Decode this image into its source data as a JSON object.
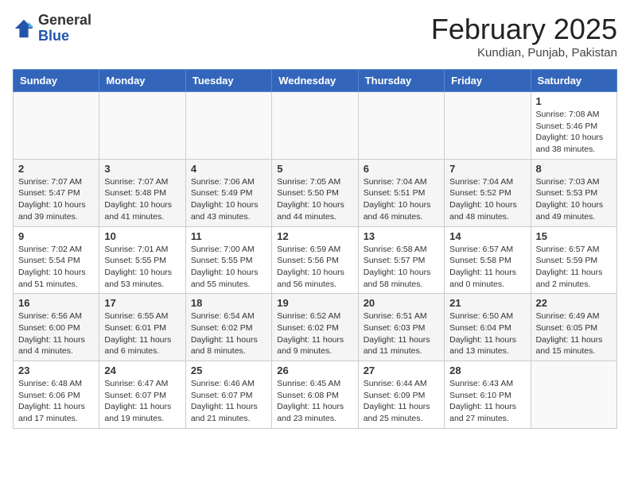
{
  "header": {
    "logo_general": "General",
    "logo_blue": "Blue",
    "month_title": "February 2025",
    "location": "Kundian, Punjab, Pakistan"
  },
  "days_of_week": [
    "Sunday",
    "Monday",
    "Tuesday",
    "Wednesday",
    "Thursday",
    "Friday",
    "Saturday"
  ],
  "weeks": [
    [
      {
        "day": "",
        "info": ""
      },
      {
        "day": "",
        "info": ""
      },
      {
        "day": "",
        "info": ""
      },
      {
        "day": "",
        "info": ""
      },
      {
        "day": "",
        "info": ""
      },
      {
        "day": "",
        "info": ""
      },
      {
        "day": "1",
        "info": "Sunrise: 7:08 AM\nSunset: 5:46 PM\nDaylight: 10 hours\nand 38 minutes."
      }
    ],
    [
      {
        "day": "2",
        "info": "Sunrise: 7:07 AM\nSunset: 5:47 PM\nDaylight: 10 hours\nand 39 minutes."
      },
      {
        "day": "3",
        "info": "Sunrise: 7:07 AM\nSunset: 5:48 PM\nDaylight: 10 hours\nand 41 minutes."
      },
      {
        "day": "4",
        "info": "Sunrise: 7:06 AM\nSunset: 5:49 PM\nDaylight: 10 hours\nand 43 minutes."
      },
      {
        "day": "5",
        "info": "Sunrise: 7:05 AM\nSunset: 5:50 PM\nDaylight: 10 hours\nand 44 minutes."
      },
      {
        "day": "6",
        "info": "Sunrise: 7:04 AM\nSunset: 5:51 PM\nDaylight: 10 hours\nand 46 minutes."
      },
      {
        "day": "7",
        "info": "Sunrise: 7:04 AM\nSunset: 5:52 PM\nDaylight: 10 hours\nand 48 minutes."
      },
      {
        "day": "8",
        "info": "Sunrise: 7:03 AM\nSunset: 5:53 PM\nDaylight: 10 hours\nand 49 minutes."
      }
    ],
    [
      {
        "day": "9",
        "info": "Sunrise: 7:02 AM\nSunset: 5:54 PM\nDaylight: 10 hours\nand 51 minutes."
      },
      {
        "day": "10",
        "info": "Sunrise: 7:01 AM\nSunset: 5:55 PM\nDaylight: 10 hours\nand 53 minutes."
      },
      {
        "day": "11",
        "info": "Sunrise: 7:00 AM\nSunset: 5:55 PM\nDaylight: 10 hours\nand 55 minutes."
      },
      {
        "day": "12",
        "info": "Sunrise: 6:59 AM\nSunset: 5:56 PM\nDaylight: 10 hours\nand 56 minutes."
      },
      {
        "day": "13",
        "info": "Sunrise: 6:58 AM\nSunset: 5:57 PM\nDaylight: 10 hours\nand 58 minutes."
      },
      {
        "day": "14",
        "info": "Sunrise: 6:57 AM\nSunset: 5:58 PM\nDaylight: 11 hours\nand 0 minutes."
      },
      {
        "day": "15",
        "info": "Sunrise: 6:57 AM\nSunset: 5:59 PM\nDaylight: 11 hours\nand 2 minutes."
      }
    ],
    [
      {
        "day": "16",
        "info": "Sunrise: 6:56 AM\nSunset: 6:00 PM\nDaylight: 11 hours\nand 4 minutes."
      },
      {
        "day": "17",
        "info": "Sunrise: 6:55 AM\nSunset: 6:01 PM\nDaylight: 11 hours\nand 6 minutes."
      },
      {
        "day": "18",
        "info": "Sunrise: 6:54 AM\nSunset: 6:02 PM\nDaylight: 11 hours\nand 8 minutes."
      },
      {
        "day": "19",
        "info": "Sunrise: 6:52 AM\nSunset: 6:02 PM\nDaylight: 11 hours\nand 9 minutes."
      },
      {
        "day": "20",
        "info": "Sunrise: 6:51 AM\nSunset: 6:03 PM\nDaylight: 11 hours\nand 11 minutes."
      },
      {
        "day": "21",
        "info": "Sunrise: 6:50 AM\nSunset: 6:04 PM\nDaylight: 11 hours\nand 13 minutes."
      },
      {
        "day": "22",
        "info": "Sunrise: 6:49 AM\nSunset: 6:05 PM\nDaylight: 11 hours\nand 15 minutes."
      }
    ],
    [
      {
        "day": "23",
        "info": "Sunrise: 6:48 AM\nSunset: 6:06 PM\nDaylight: 11 hours\nand 17 minutes."
      },
      {
        "day": "24",
        "info": "Sunrise: 6:47 AM\nSunset: 6:07 PM\nDaylight: 11 hours\nand 19 minutes."
      },
      {
        "day": "25",
        "info": "Sunrise: 6:46 AM\nSunset: 6:07 PM\nDaylight: 11 hours\nand 21 minutes."
      },
      {
        "day": "26",
        "info": "Sunrise: 6:45 AM\nSunset: 6:08 PM\nDaylight: 11 hours\nand 23 minutes."
      },
      {
        "day": "27",
        "info": "Sunrise: 6:44 AM\nSunset: 6:09 PM\nDaylight: 11 hours\nand 25 minutes."
      },
      {
        "day": "28",
        "info": "Sunrise: 6:43 AM\nSunset: 6:10 PM\nDaylight: 11 hours\nand 27 minutes."
      },
      {
        "day": "",
        "info": ""
      }
    ]
  ]
}
